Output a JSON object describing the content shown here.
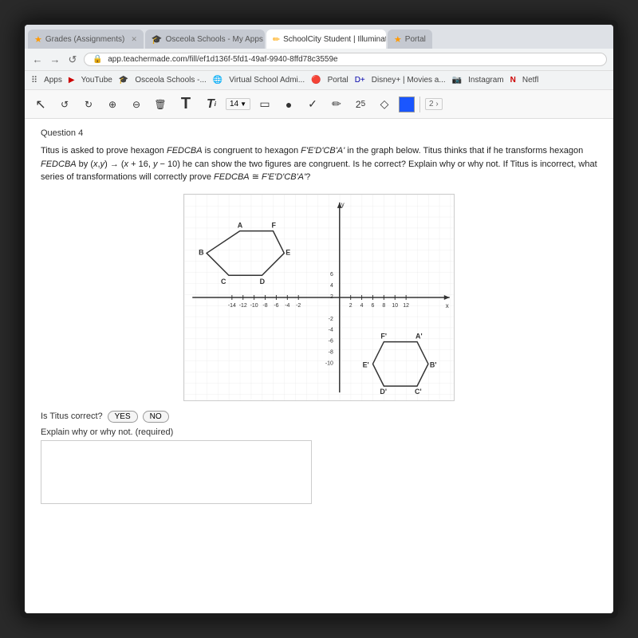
{
  "tabs": [
    {
      "id": "grades",
      "label": "Grades (Assignments)",
      "active": false,
      "icon": "★"
    },
    {
      "id": "osceola",
      "label": "Osceola Schools - My Apps",
      "active": false,
      "icon": "🎓"
    },
    {
      "id": "schoolcity",
      "label": "SchoolCity Student | Illuminate F",
      "active": true,
      "icon": "✏"
    },
    {
      "id": "portal",
      "label": "Portal",
      "active": false,
      "icon": "★"
    }
  ],
  "address": "app.teachermade.com/fill/ef1d136f-5fd1-49af-9940-8ffd78c3559e",
  "bookmarks": [
    "Apps",
    "YouTube",
    "Osceola Schools -...",
    "Virtual School Admi...",
    "Portal",
    "Disney+ | Movies a...",
    "Instagram",
    "Netfl"
  ],
  "toolbar": {
    "undo_icon": "↺",
    "redo_icon": "↻",
    "zoom_in_icon": "⊕",
    "zoom_out_icon": "⊖",
    "trash_icon": "🗑",
    "text_T": "T",
    "text_Ti": "Ti",
    "font_size": "14",
    "rect_icon": "▭",
    "circle_icon": "●",
    "check_icon": "✓",
    "pencil_icon": "✏",
    "number_icon": "2₅",
    "shape_icon": "◇",
    "page_info": "2 ›"
  },
  "question": {
    "number": "Question 4",
    "text": "Titus is asked to prove hexagon FEDCBA is congruent to hexagon F'E'D'CB'A' in the graph below. Titus thinks that if he transforms hexagon FEDCBA by (x,y) → (x + 16, y − 10) he can show the two figures are congruent. Is he correct? Explain why or why not. If Titus is incorrect, what series of transformations will correctly prove FEDCBA ≅ F'E'D'CB'A'?"
  },
  "graph": {
    "title": "Coordinate plane with two hexagons",
    "hexagon1_points": "A,F on top; B left; E right; C,D on bottom",
    "hexagon2_points": "F',A' on top; E' left; B' right; D',C' on bottom"
  },
  "answer": {
    "correct_label": "Is Titus correct?",
    "yes_label": "YES",
    "no_label": "NO",
    "explain_label": "Explain why or why not. (required)",
    "text_placeholder": ""
  }
}
